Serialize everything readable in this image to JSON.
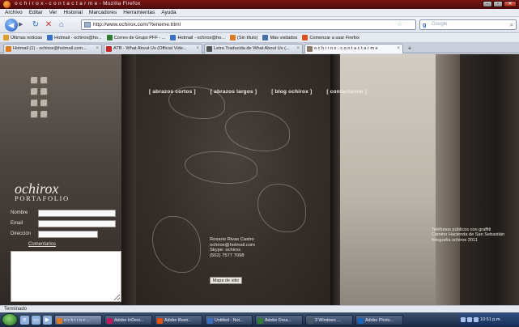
{
  "window": {
    "title": "o c h i r o x - c o n t a c t a r m e - Mozilla Firefox"
  },
  "menu": [
    "Archivo",
    "Editar",
    "Ver",
    "Historial",
    "Marcadores",
    "Herramientas",
    "Ayuda"
  ],
  "navigation": {
    "url": "http://www.ochirox.com/?teneme.html",
    "search_placeholder": "Google"
  },
  "bookmarks": [
    {
      "label": "Últimas noticias",
      "color": "#e0a030"
    },
    {
      "label": "Hotmail - ochirox@ho...",
      "color": "#3b6fc4"
    },
    {
      "label": "Correo de Grupo PFF - ...",
      "color": "#2e7d32"
    },
    {
      "label": "Hotmail - ochirox@ho...",
      "color": "#3b6fc4"
    },
    {
      "label": "(Sin título)",
      "color": "#e07b25"
    },
    {
      "label": "Más visitados",
      "color": "#4a6fa5"
    },
    {
      "label": "Comenzar a usar Firefox",
      "color": "#d9531e"
    }
  ],
  "tabs": [
    {
      "label": "Hotmail (1) - ochirox@hotmail.com...",
      "color": "#e07b25",
      "active": false
    },
    {
      "label": "ATB - What About Us (Official Vide...",
      "color": "#c62828",
      "active": false
    },
    {
      "label": "Letra Traducida de What About Us (...",
      "color": "#555555",
      "active": false
    },
    {
      "label": "o c h i r o x - c o n t a c t a r m e",
      "color": "#8a7a6a",
      "active": true
    }
  ],
  "site": {
    "nav": [
      "[ abrazos cortos ]",
      "[ abrazos largos ]",
      "[ blog ochirox ]",
      "[ contactarme ]"
    ],
    "logo_name": "ochirox",
    "logo_sub": "PORTAFOLIO",
    "form": {
      "name_label": "Nombre",
      "email_label": "Email",
      "address_label": "Dirección",
      "message_label": "Comentarios"
    },
    "contact_lines": [
      "Rosario Rivas Castro",
      "ochirox@hotmail.com",
      "Skype: ochirox",
      "(502) 7577 7098"
    ],
    "map_button": "Mapa de sitio",
    "caption_lines": [
      "Teléfonos públicos con graffiti",
      "Camino Hacienda de San Sebastián",
      "fotografía ochirox 2011"
    ]
  },
  "status": {
    "text": "Terminado"
  },
  "taskbar": {
    "tasks": [
      {
        "label": "o c h i r o x ...",
        "color": "#e07b25",
        "active": true
      },
      {
        "label": "Adobe InDesi...",
        "color": "#c2185b",
        "active": false
      },
      {
        "label": "Adobe Illustr...",
        "color": "#e65100",
        "active": false
      },
      {
        "label": "Untitled - Not...",
        "color": "#3b6fc4",
        "active": false
      },
      {
        "label": "Adobe Drea...",
        "color": "#2e7d32",
        "active": false
      },
      {
        "label": "3 Windows ...",
        "color": "#455a64",
        "active": false
      },
      {
        "label": "Adobe Photo...",
        "color": "#1565c0",
        "active": false
      }
    ],
    "clock": "10:51 p.m."
  }
}
